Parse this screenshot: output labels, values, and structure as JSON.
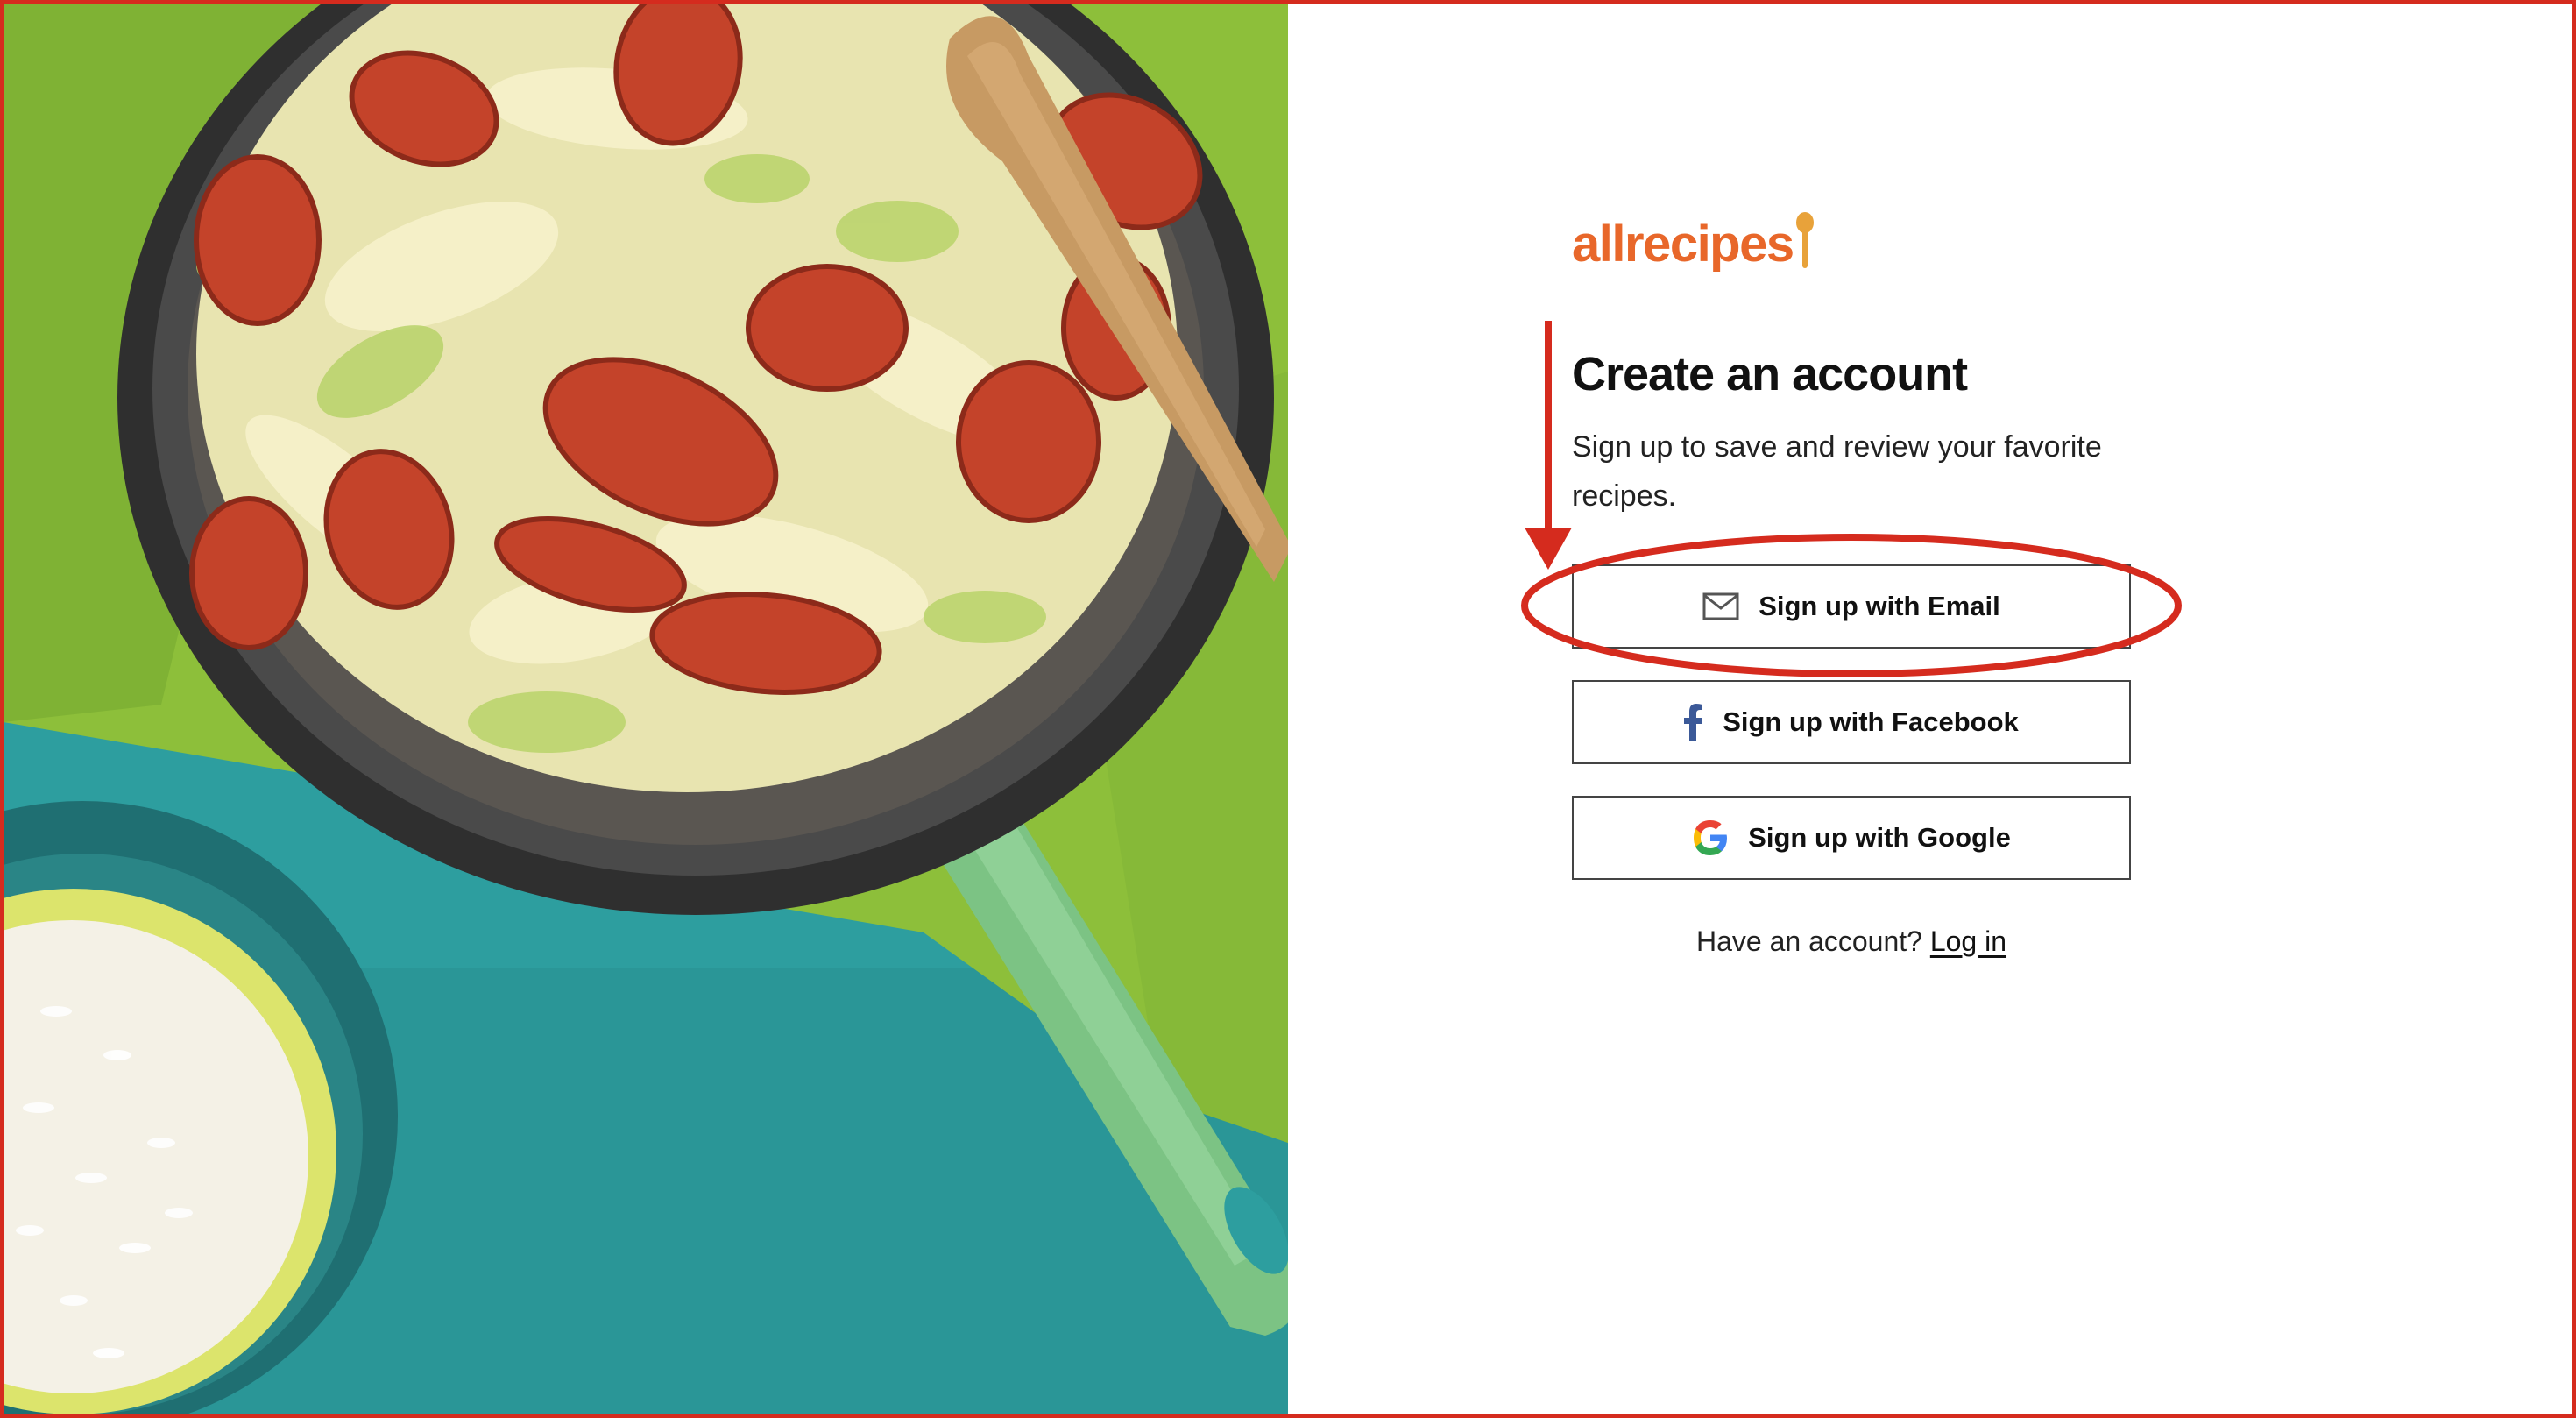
{
  "brand": {
    "logo_text": "allrecipes",
    "accent_color": "#e8672a"
  },
  "hero": {
    "image_description_icon": "food-photo"
  },
  "signup": {
    "title": "Create an account",
    "subtitle": "Sign up to save and review your favorite recipes.",
    "buttons": [
      {
        "label": "Sign up with Email",
        "icon": "mail-icon"
      },
      {
        "label": "Sign up with Facebook",
        "icon": "facebook-icon"
      },
      {
        "label": "Sign up with Google",
        "icon": "google-icon"
      }
    ],
    "login_prompt": "Have an account?",
    "login_link": "Log in"
  },
  "annotation": {
    "color": "#d52b1e"
  }
}
